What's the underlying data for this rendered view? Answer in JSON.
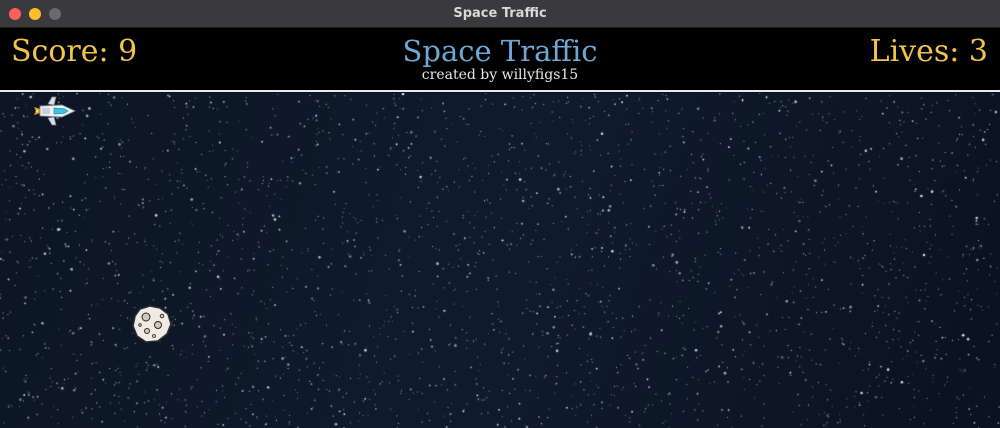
{
  "window": {
    "title": "Space Traffic"
  },
  "hud": {
    "score_text": "Score: 9",
    "lives_text": "Lives: 3",
    "title": "Space Traffic",
    "credit": "created by willyfigs15"
  },
  "game": {
    "score": 9,
    "lives": 3
  },
  "colors": {
    "hud_text": "#f3c44b",
    "title_text": "#6ea8d8",
    "credit_text": "#e6e6e6",
    "space_bg": "#0d1726",
    "hud_bg": "#000000"
  },
  "icons": {
    "player": "spaceship-icon",
    "obstacle": "asteroid-icon"
  }
}
